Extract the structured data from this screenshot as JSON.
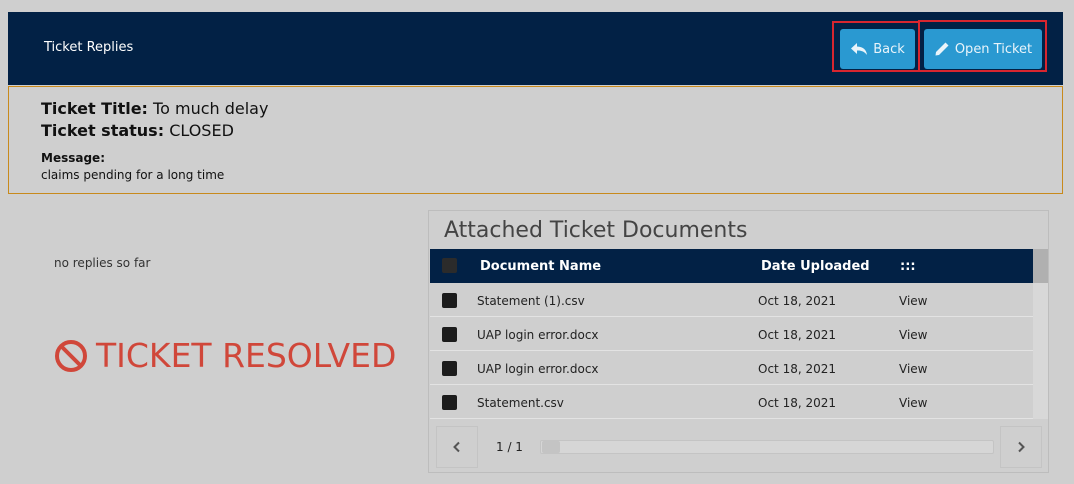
{
  "header": {
    "title": "Ticket Replies",
    "back_label": "Back",
    "open_ticket_label": "Open Ticket",
    "highlight_color": "#d8262f"
  },
  "ticket": {
    "title_label": "Ticket Title:",
    "title_value": "To much delay",
    "status_label": "Ticket status:",
    "status_value": "CLOSED",
    "message_label": "Message:",
    "message_text": "claims pending for a long time"
  },
  "replies": {
    "empty_text": "no replies so far",
    "resolved_text": "TICKET RESOLVED",
    "resolved_icon": "ban-icon"
  },
  "documents": {
    "title": "Attached Ticket Documents",
    "columns": [
      "Document Name",
      "Date Uploaded",
      ":::"
    ],
    "rows": [
      {
        "name": "Statement (1).csv",
        "date": "Oct 18, 2021",
        "action": "View"
      },
      {
        "name": "UAP login error.docx",
        "date": "Oct 18, 2021",
        "action": "View"
      },
      {
        "name": "UAP login error.docx",
        "date": "Oct 18, 2021",
        "action": "View"
      },
      {
        "name": "Statement.csv",
        "date": "Oct 18, 2021",
        "action": "View"
      }
    ],
    "pager": {
      "page_text": "1 / 1",
      "prev_icon": "chevron-left-icon",
      "next_icon": "chevron-right-icon"
    }
  },
  "colors": {
    "header_bg": "#022145",
    "button_bg": "#2a99d1",
    "info_border": "#c88a1c",
    "resolved": "#d0473a"
  }
}
